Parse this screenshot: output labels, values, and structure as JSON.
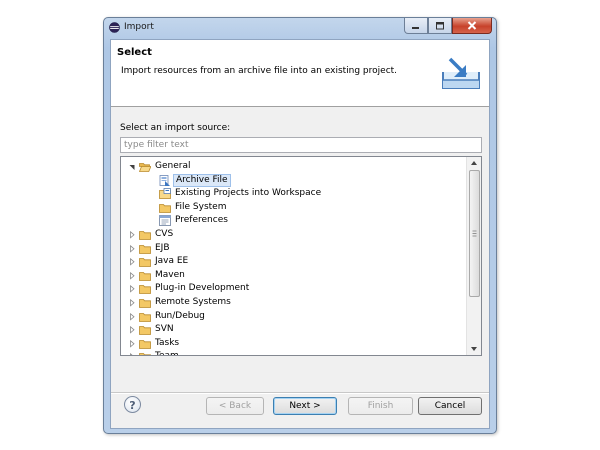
{
  "window": {
    "title": "Import",
    "controls": [
      "minimize",
      "maximize",
      "close"
    ]
  },
  "header": {
    "title": "Select",
    "description": "Import resources from an archive file into an existing project.",
    "icon": "import-archive-icon"
  },
  "source": {
    "label": "Select an import source:",
    "filter_placeholder": "type filter text",
    "filter_value": ""
  },
  "tree": {
    "items": [
      {
        "label": "General",
        "expanded": true,
        "level": 0,
        "icon": "folder-open-icon"
      },
      {
        "label": "Archive File",
        "level": 1,
        "selected": true,
        "icon": "archive-file-icon"
      },
      {
        "label": "Existing Projects into Workspace",
        "level": 1,
        "icon": "project-icon"
      },
      {
        "label": "File System",
        "level": 1,
        "icon": "folder-icon"
      },
      {
        "label": "Preferences",
        "level": 1,
        "icon": "preferences-icon"
      },
      {
        "label": "CVS",
        "expanded": false,
        "level": 0,
        "icon": "folder-icon"
      },
      {
        "label": "EJB",
        "expanded": false,
        "level": 0,
        "icon": "folder-icon"
      },
      {
        "label": "Java EE",
        "expanded": false,
        "level": 0,
        "icon": "folder-icon"
      },
      {
        "label": "Maven",
        "expanded": false,
        "level": 0,
        "icon": "folder-icon"
      },
      {
        "label": "Plug-in Development",
        "expanded": false,
        "level": 0,
        "icon": "folder-icon"
      },
      {
        "label": "Remote Systems",
        "expanded": false,
        "level": 0,
        "icon": "folder-icon"
      },
      {
        "label": "Run/Debug",
        "expanded": false,
        "level": 0,
        "icon": "folder-icon"
      },
      {
        "label": "SVN",
        "expanded": false,
        "level": 0,
        "icon": "folder-icon"
      },
      {
        "label": "Tasks",
        "expanded": false,
        "level": 0,
        "icon": "folder-icon"
      },
      {
        "label": "Team",
        "expanded": false,
        "level": 0,
        "icon": "folder-icon"
      }
    ]
  },
  "buttons": {
    "help": "?",
    "back": "< Back",
    "next": "Next >",
    "finish": "Finish",
    "cancel": "Cancel"
  },
  "colors": {
    "selection": "#dbe8f8",
    "frame": "#b9cfe9",
    "folder": "#f3c865"
  }
}
